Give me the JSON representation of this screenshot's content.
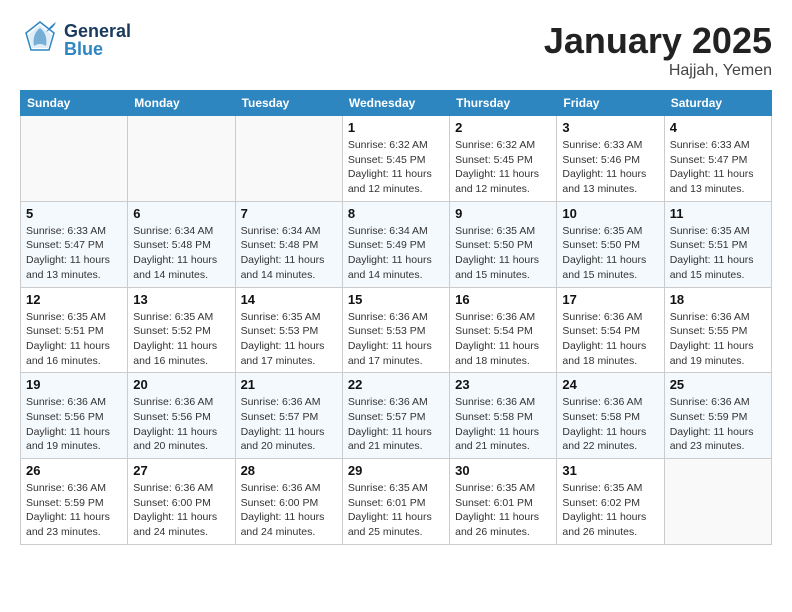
{
  "header": {
    "logo_general": "General",
    "logo_blue": "Blue",
    "month": "January 2025",
    "location": "Hajjah, Yemen"
  },
  "days_of_week": [
    "Sunday",
    "Monday",
    "Tuesday",
    "Wednesday",
    "Thursday",
    "Friday",
    "Saturday"
  ],
  "weeks": [
    [
      {
        "day": "",
        "info": ""
      },
      {
        "day": "",
        "info": ""
      },
      {
        "day": "",
        "info": ""
      },
      {
        "day": "1",
        "info": "Sunrise: 6:32 AM\nSunset: 5:45 PM\nDaylight: 11 hours and 12 minutes."
      },
      {
        "day": "2",
        "info": "Sunrise: 6:32 AM\nSunset: 5:45 PM\nDaylight: 11 hours and 12 minutes."
      },
      {
        "day": "3",
        "info": "Sunrise: 6:33 AM\nSunset: 5:46 PM\nDaylight: 11 hours and 13 minutes."
      },
      {
        "day": "4",
        "info": "Sunrise: 6:33 AM\nSunset: 5:47 PM\nDaylight: 11 hours and 13 minutes."
      }
    ],
    [
      {
        "day": "5",
        "info": "Sunrise: 6:33 AM\nSunset: 5:47 PM\nDaylight: 11 hours and 13 minutes."
      },
      {
        "day": "6",
        "info": "Sunrise: 6:34 AM\nSunset: 5:48 PM\nDaylight: 11 hours and 14 minutes."
      },
      {
        "day": "7",
        "info": "Sunrise: 6:34 AM\nSunset: 5:48 PM\nDaylight: 11 hours and 14 minutes."
      },
      {
        "day": "8",
        "info": "Sunrise: 6:34 AM\nSunset: 5:49 PM\nDaylight: 11 hours and 14 minutes."
      },
      {
        "day": "9",
        "info": "Sunrise: 6:35 AM\nSunset: 5:50 PM\nDaylight: 11 hours and 15 minutes."
      },
      {
        "day": "10",
        "info": "Sunrise: 6:35 AM\nSunset: 5:50 PM\nDaylight: 11 hours and 15 minutes."
      },
      {
        "day": "11",
        "info": "Sunrise: 6:35 AM\nSunset: 5:51 PM\nDaylight: 11 hours and 15 minutes."
      }
    ],
    [
      {
        "day": "12",
        "info": "Sunrise: 6:35 AM\nSunset: 5:51 PM\nDaylight: 11 hours and 16 minutes."
      },
      {
        "day": "13",
        "info": "Sunrise: 6:35 AM\nSunset: 5:52 PM\nDaylight: 11 hours and 16 minutes."
      },
      {
        "day": "14",
        "info": "Sunrise: 6:35 AM\nSunset: 5:53 PM\nDaylight: 11 hours and 17 minutes."
      },
      {
        "day": "15",
        "info": "Sunrise: 6:36 AM\nSunset: 5:53 PM\nDaylight: 11 hours and 17 minutes."
      },
      {
        "day": "16",
        "info": "Sunrise: 6:36 AM\nSunset: 5:54 PM\nDaylight: 11 hours and 18 minutes."
      },
      {
        "day": "17",
        "info": "Sunrise: 6:36 AM\nSunset: 5:54 PM\nDaylight: 11 hours and 18 minutes."
      },
      {
        "day": "18",
        "info": "Sunrise: 6:36 AM\nSunset: 5:55 PM\nDaylight: 11 hours and 19 minutes."
      }
    ],
    [
      {
        "day": "19",
        "info": "Sunrise: 6:36 AM\nSunset: 5:56 PM\nDaylight: 11 hours and 19 minutes."
      },
      {
        "day": "20",
        "info": "Sunrise: 6:36 AM\nSunset: 5:56 PM\nDaylight: 11 hours and 20 minutes."
      },
      {
        "day": "21",
        "info": "Sunrise: 6:36 AM\nSunset: 5:57 PM\nDaylight: 11 hours and 20 minutes."
      },
      {
        "day": "22",
        "info": "Sunrise: 6:36 AM\nSunset: 5:57 PM\nDaylight: 11 hours and 21 minutes."
      },
      {
        "day": "23",
        "info": "Sunrise: 6:36 AM\nSunset: 5:58 PM\nDaylight: 11 hours and 21 minutes."
      },
      {
        "day": "24",
        "info": "Sunrise: 6:36 AM\nSunset: 5:58 PM\nDaylight: 11 hours and 22 minutes."
      },
      {
        "day": "25",
        "info": "Sunrise: 6:36 AM\nSunset: 5:59 PM\nDaylight: 11 hours and 23 minutes."
      }
    ],
    [
      {
        "day": "26",
        "info": "Sunrise: 6:36 AM\nSunset: 5:59 PM\nDaylight: 11 hours and 23 minutes."
      },
      {
        "day": "27",
        "info": "Sunrise: 6:36 AM\nSunset: 6:00 PM\nDaylight: 11 hours and 24 minutes."
      },
      {
        "day": "28",
        "info": "Sunrise: 6:36 AM\nSunset: 6:00 PM\nDaylight: 11 hours and 24 minutes."
      },
      {
        "day": "29",
        "info": "Sunrise: 6:35 AM\nSunset: 6:01 PM\nDaylight: 11 hours and 25 minutes."
      },
      {
        "day": "30",
        "info": "Sunrise: 6:35 AM\nSunset: 6:01 PM\nDaylight: 11 hours and 26 minutes."
      },
      {
        "day": "31",
        "info": "Sunrise: 6:35 AM\nSunset: 6:02 PM\nDaylight: 11 hours and 26 minutes."
      },
      {
        "day": "",
        "info": ""
      }
    ]
  ]
}
